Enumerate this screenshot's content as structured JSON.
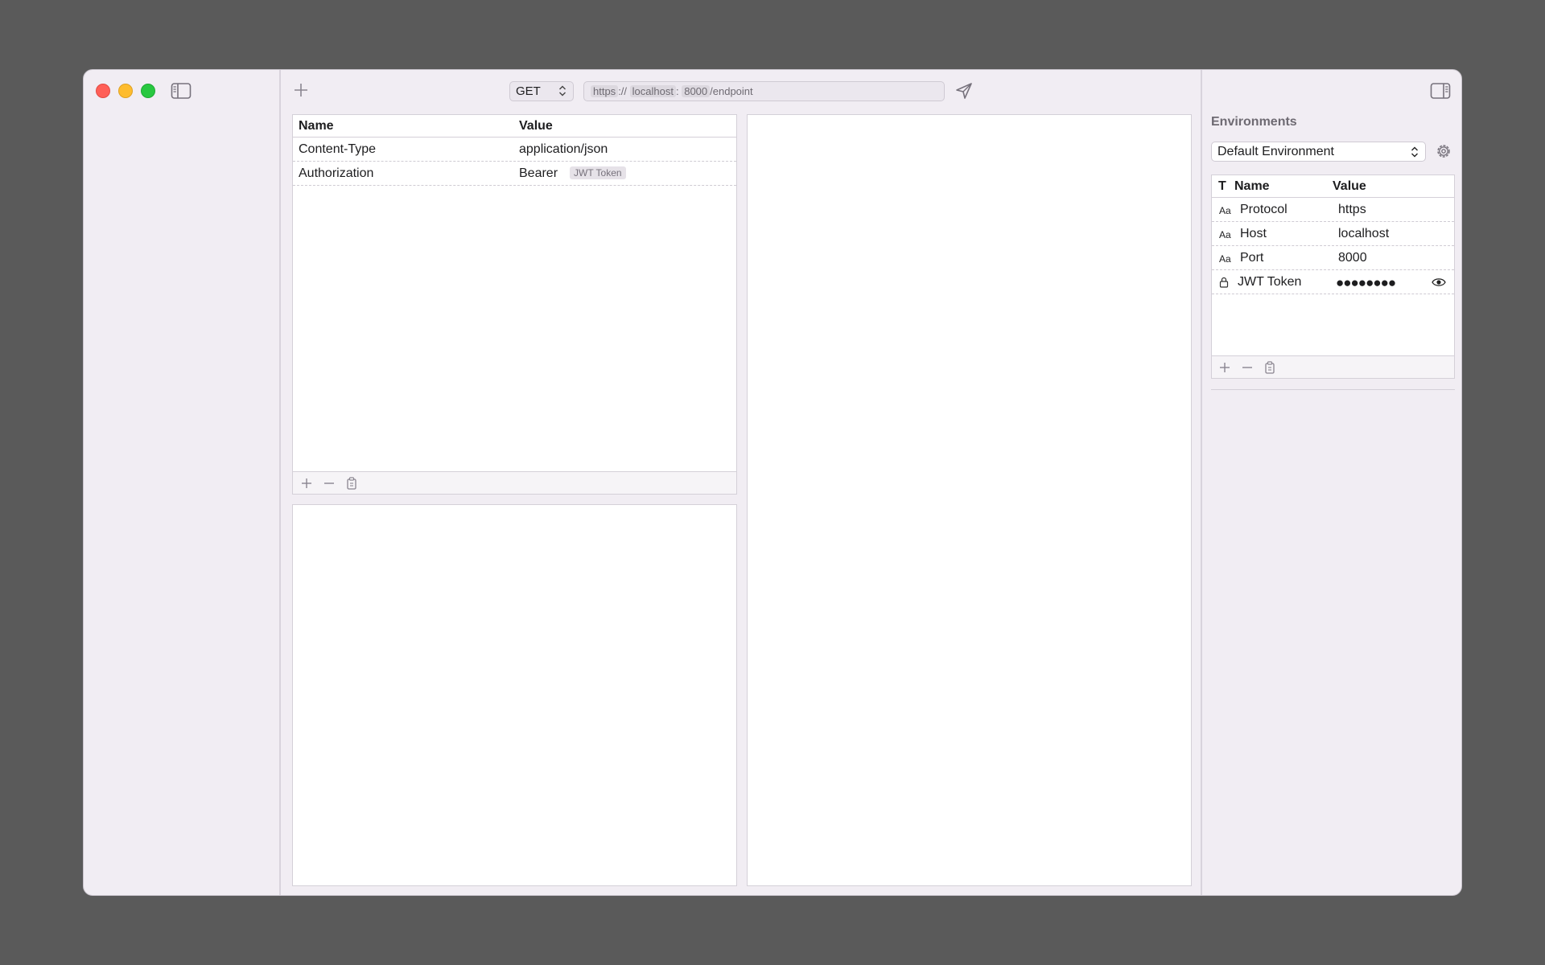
{
  "request": {
    "method": "GET",
    "url_parts": [
      "https",
      "://",
      "localhost",
      ":",
      "8000",
      "/endpoint"
    ]
  },
  "headers": {
    "columns": [
      "Name",
      "Value"
    ],
    "rows": [
      {
        "name": "Content-Type",
        "value": "application/json"
      },
      {
        "name": "Authorization",
        "value": "Bearer",
        "variable": "JWT Token"
      }
    ]
  },
  "environments": {
    "title": "Environments",
    "selected": "Default Environment",
    "columns": [
      "T",
      "Name",
      "Value"
    ],
    "rows": [
      {
        "type": "Aa",
        "name": "Protocol",
        "value": "https"
      },
      {
        "type": "Aa",
        "name": "Host",
        "value": "localhost"
      },
      {
        "type": "Aa",
        "name": "Port",
        "value": "8000"
      },
      {
        "type": "lock-icon",
        "name": "JWT Token",
        "value": "●●●●●●●●"
      }
    ]
  },
  "colors": {
    "close": "#ff5f57",
    "minimize": "#febc2e",
    "zoom": "#28c840"
  }
}
